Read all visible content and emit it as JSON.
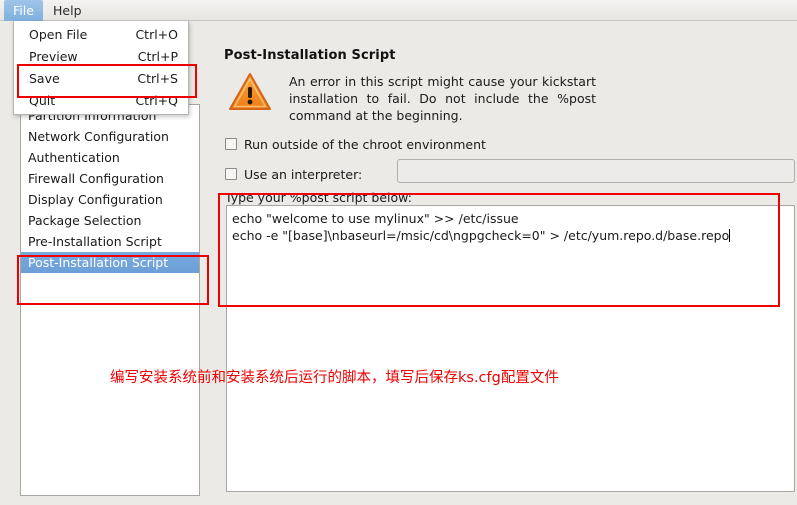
{
  "menubar": {
    "items": [
      {
        "label": "File",
        "open": true
      },
      {
        "label": "Help",
        "open": false
      }
    ]
  },
  "file_menu": {
    "items": [
      {
        "label": "Open File",
        "accel": "Ctrl+O"
      },
      {
        "label": "Preview",
        "accel": "Ctrl+P"
      },
      {
        "label": "Save",
        "accel": "Ctrl+S"
      },
      {
        "label": "Quit",
        "accel": "Ctrl+Q"
      }
    ]
  },
  "sidebar": {
    "items": [
      {
        "label": "Partition Information",
        "selected": false
      },
      {
        "label": "Network Configuration",
        "selected": false
      },
      {
        "label": "Authentication",
        "selected": false
      },
      {
        "label": "Firewall Configuration",
        "selected": false
      },
      {
        "label": "Display Configuration",
        "selected": false
      },
      {
        "label": "Package Selection",
        "selected": false
      },
      {
        "label": "Pre-Installation Script",
        "selected": false
      },
      {
        "label": "Post-Installation Script",
        "selected": true
      }
    ]
  },
  "main": {
    "title": "Post-Installation Script",
    "warning_text": "An error in this script might cause your kickstart installation to fail. Do not include the %post command at the beginning.",
    "checkbox_chroot": {
      "label": "Run outside of the chroot environment",
      "checked": false
    },
    "checkbox_interpreter": {
      "label": "Use an interpreter:",
      "checked": false
    },
    "interpreter_value": "",
    "interpreter_placeholder": "",
    "script_label": "Type your %post script below:",
    "script_lines": [
      "echo \"welcome to use mylinux\" >> /etc/issue",
      "echo -e \"[base]\\nbaseurl=/msic/cd\\ngpgcheck=0\" > /etc/yum.repo.d/base.repo"
    ]
  },
  "annotations": {
    "color": "#ee0000",
    "note": "编写安装系统前和安装系统后运行的脚本，填写后保存ks.cfg配置文件",
    "boxes": [
      "save-menu-item",
      "script-sidebar-items",
      "script-textarea"
    ]
  }
}
